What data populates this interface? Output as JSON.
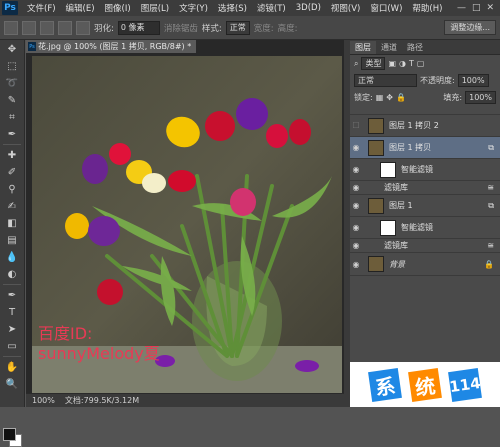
{
  "app": {
    "logo": "Ps"
  },
  "menubar": {
    "items": [
      "文件(F)",
      "编辑(E)",
      "图像(I)",
      "图层(L)",
      "文字(Y)",
      "选择(S)",
      "滤镜(T)",
      "3D(D)",
      "视图(V)",
      "窗口(W)",
      "帮助(H)"
    ],
    "window_controls": [
      "—",
      "□",
      "✕"
    ]
  },
  "options": {
    "feather_label": "羽化:",
    "feather_value": "0 像素",
    "antialias_label": "消除锯齿",
    "style_label": "样式:",
    "style_value": "正常",
    "width_label": "宽度:",
    "height_label": "高度:",
    "refine_button": "调整边缘..."
  },
  "document": {
    "tab_title": "花.jpg @ 100% (图层 1 拷贝, RGB/8#) *",
    "watermark_line1": "百度ID:",
    "watermark_line2": "sunnyMelody夏",
    "status_zoom": "100%",
    "status_doc": "文档:799.5K/3.12M"
  },
  "panel": {
    "tabs": [
      "图层",
      "通道",
      "路径"
    ],
    "kind_select": "类型",
    "blend_mode": "正常",
    "opacity_label": "不透明度:",
    "opacity_value": "100%",
    "lock_label": "锁定:",
    "fill_label": "填充:",
    "fill_value": "100%",
    "layers": [
      {
        "name": "图层 1 拷贝 2",
        "visible": false,
        "selected": false,
        "type": "image"
      },
      {
        "name": "图层 1 拷贝",
        "visible": true,
        "selected": true,
        "type": "image"
      },
      {
        "name": "智能滤镜",
        "visible": true,
        "selected": false,
        "type": "smart"
      },
      {
        "name": "滤镜库",
        "visible": true,
        "selected": false,
        "type": "filter"
      },
      {
        "name": "图层 1",
        "visible": true,
        "selected": false,
        "type": "image"
      },
      {
        "name": "智能滤镜",
        "visible": true,
        "selected": false,
        "type": "smart"
      },
      {
        "name": "滤镜库",
        "visible": true,
        "selected": false,
        "type": "filter"
      },
      {
        "name": "背景",
        "visible": true,
        "selected": false,
        "type": "image"
      }
    ]
  },
  "site_watermark": {
    "chars": [
      "系",
      "统",
      "114"
    ],
    "colors": [
      "#1e88e5",
      "#ff8a00",
      "#1e88e5"
    ]
  }
}
